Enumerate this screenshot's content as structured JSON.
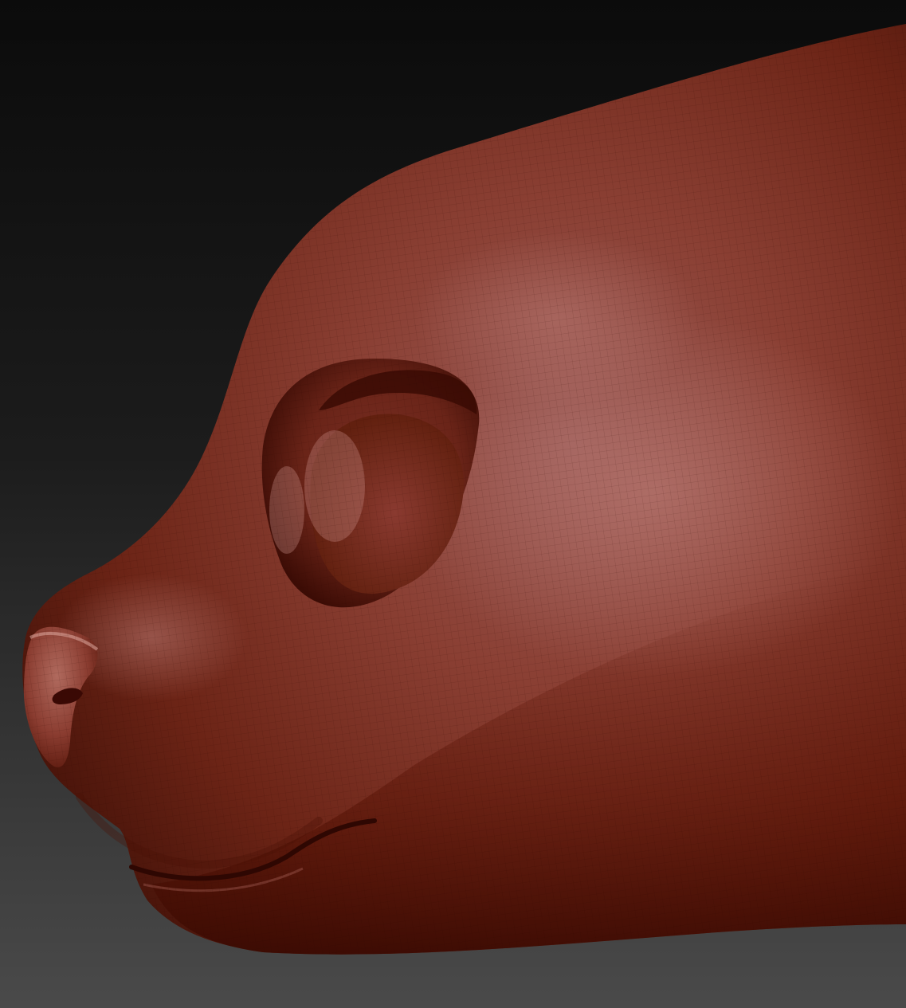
{
  "scene": {
    "subject": "sculpt-model",
    "colors": {
      "background_top": "#0d0d0d",
      "background_bottom": "#4a4a4a",
      "clay_base": "#7a2a1c",
      "clay_light": "#a0605c",
      "clay_dark": "#3a0c06",
      "clay_shadow": "#5a1408"
    },
    "wireframe_visible": true
  }
}
